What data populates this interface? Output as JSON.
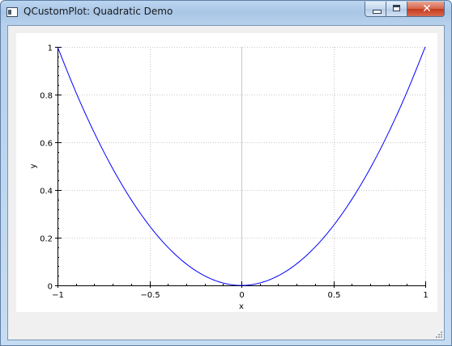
{
  "window": {
    "title": "QCustomPlot: Quadratic Demo",
    "icons": {
      "app": "app-window-icon",
      "minimize": "minimize-icon",
      "maximize": "maximize-icon",
      "close": "close-icon"
    },
    "close_glyph": "✕"
  },
  "chart_data": {
    "type": "line",
    "title": "",
    "xlabel": "x",
    "ylabel": "y",
    "xlim": [
      -1,
      1
    ],
    "ylim": [
      0,
      1
    ],
    "x_ticks": [
      -1,
      -0.5,
      0,
      0.5,
      1
    ],
    "x_tick_labels": [
      "−1",
      "−0.5",
      "0",
      "0.5",
      "1"
    ],
    "y_ticks": [
      0,
      0.2,
      0.4,
      0.6,
      0.8,
      1
    ],
    "y_tick_labels": [
      "0",
      "0.2",
      "0.4",
      "0.6",
      "0.8",
      "1"
    ],
    "grid": true,
    "legend": "none",
    "colors": {
      "series": "#0000ff",
      "grid": "#c8c8c8",
      "zero_line": "#c8c8c8",
      "axis": "#000000"
    },
    "series": [
      {
        "function": "y = x^2",
        "x": [
          -1,
          -0.9,
          -0.8,
          -0.7,
          -0.6,
          -0.5,
          -0.4,
          -0.3,
          -0.2,
          -0.1,
          0,
          0.1,
          0.2,
          0.3,
          0.4,
          0.5,
          0.6,
          0.7,
          0.8,
          0.9,
          1
        ],
        "y": [
          1,
          0.81,
          0.64,
          0.49,
          0.36,
          0.25,
          0.16,
          0.09,
          0.04,
          0.01,
          0,
          0.01,
          0.04,
          0.09,
          0.16,
          0.25,
          0.36,
          0.49,
          0.64,
          0.81,
          1
        ]
      }
    ]
  }
}
